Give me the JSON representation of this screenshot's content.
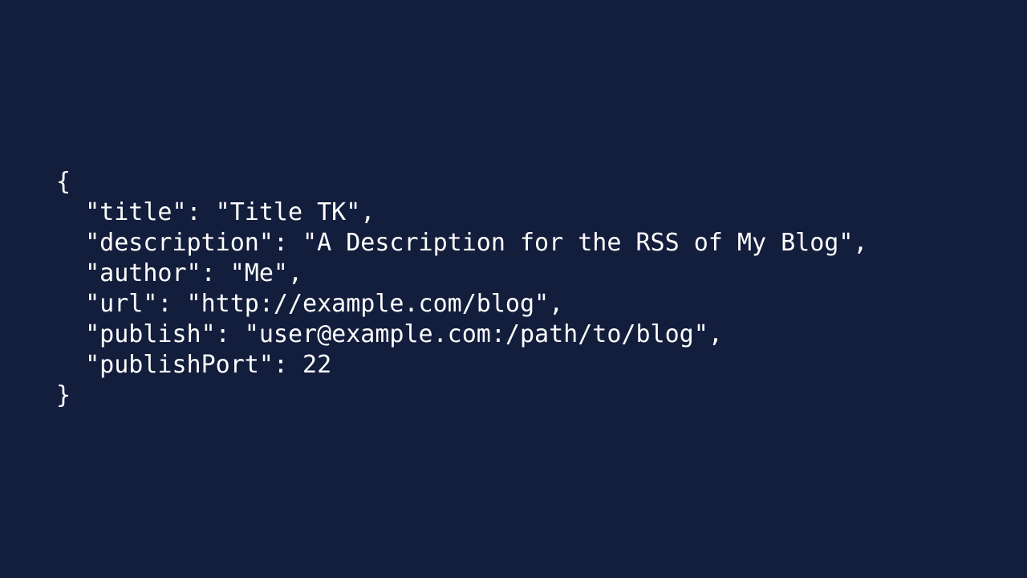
{
  "background_color": "#131d3c",
  "text_color": "#ffffff",
  "code": {
    "lines": [
      "{",
      "  \"title\": \"Title TK\",",
      "  \"description\": \"A Description for the RSS of My Blog\",",
      "  \"author\": \"Me\",",
      "  \"url\": \"http://example.com/blog\",",
      "  \"publish\": \"user@example.com:/path/to/blog\",",
      "  \"publishPort\": 22",
      "}"
    ]
  }
}
